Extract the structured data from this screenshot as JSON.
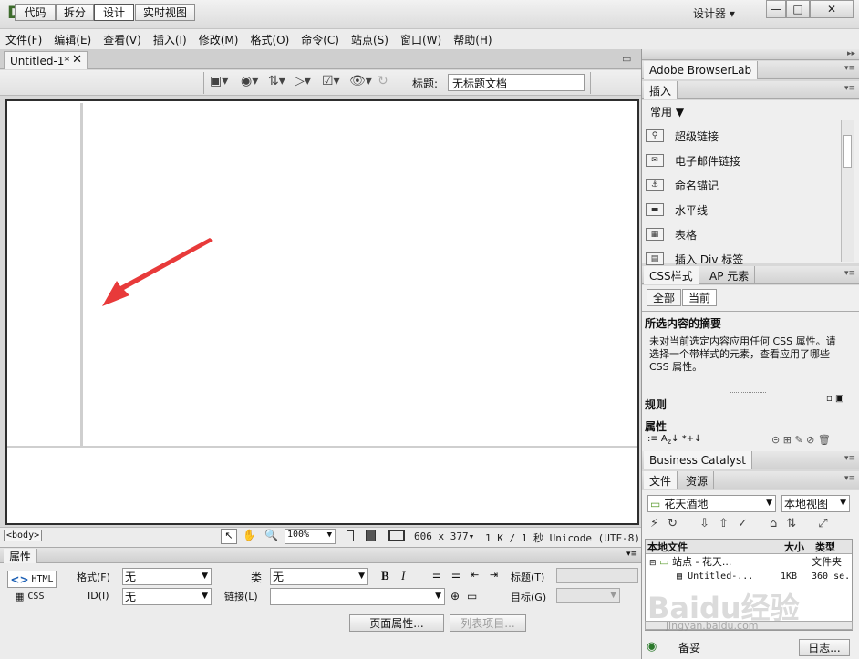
{
  "app": {
    "logo": "Dw",
    "workspace": "设计器",
    "win_min": "—",
    "win_max": "□",
    "win_close": "✕"
  },
  "menu": [
    "文件(F)",
    "编辑(E)",
    "查看(V)",
    "插入(I)",
    "修改(M)",
    "格式(O)",
    "命令(C)",
    "站点(S)",
    "窗口(W)",
    "帮助(H)"
  ],
  "document": {
    "tab": "Untitled-1*",
    "close": "✕"
  },
  "view_buttons": {
    "code": "代码",
    "split": "拆分",
    "design": "设计",
    "live": "实时视图"
  },
  "title": {
    "label": "标题:",
    "value": "无标题文档"
  },
  "status": {
    "tag": "<body>",
    "zoom": "100%",
    "size": "606 x 377",
    "size_arrow": "▾",
    "info": "1 K / 1 秒 Unicode (UTF-8)"
  },
  "properties": {
    "header": "属性",
    "html": "HTML",
    "css": "CSS",
    "format_label": "格式(F)",
    "format_value": "无",
    "class_label": "类",
    "class_value": "无",
    "id_label": "ID(I)",
    "id_value": "无",
    "link_label": "链接(L)",
    "link_value": "",
    "title_label": "标题(T)",
    "target_label": "目标(G)",
    "page_props": "页面属性...",
    "list_item": "列表项目..."
  },
  "panels": {
    "browserlab": "Adobe BrowserLab",
    "insert_tab": "插入",
    "insert_category": "常用",
    "insert_items": [
      {
        "label": "超级链接",
        "icon": "hyperlink-icon"
      },
      {
        "label": "电子邮件链接",
        "icon": "email-link-icon"
      },
      {
        "label": "命名锚记",
        "icon": "named-anchor-icon"
      },
      {
        "label": "水平线",
        "icon": "horizontal-rule-icon"
      },
      {
        "label": "表格",
        "icon": "table-icon"
      },
      {
        "label": "插入 Div 标签",
        "icon": "div-tag-icon"
      }
    ],
    "css_tab": "CSS样式",
    "ap_tab": "AP 元素",
    "css_all": "全部",
    "css_current": "当前",
    "summary_title": "所选内容的摘要",
    "summary_text": "未对当前选定内容应用任何 CSS 属性。请选择一个带样式的元素，查看应用了哪些 CSS 属性。",
    "rules": "规则",
    "props": "属性",
    "bc_tab": "Business Catalyst",
    "files_tab": "文件",
    "assets_tab": "资源",
    "site": "花天酒地",
    "view": "本地视图",
    "col_local": "本地文件",
    "col_size": "大小",
    "col_type": "类型",
    "tree": [
      {
        "name": "站点 - 花天...",
        "size": "",
        "type": "文件夹"
      },
      {
        "name": "Untitled-...",
        "size": "1KB",
        "type": "360 se."
      }
    ],
    "footer_left": "备妥",
    "footer_log": "日志..."
  },
  "watermark": "Baidu经验",
  "watermark_url": "jingyan.baidu.com"
}
